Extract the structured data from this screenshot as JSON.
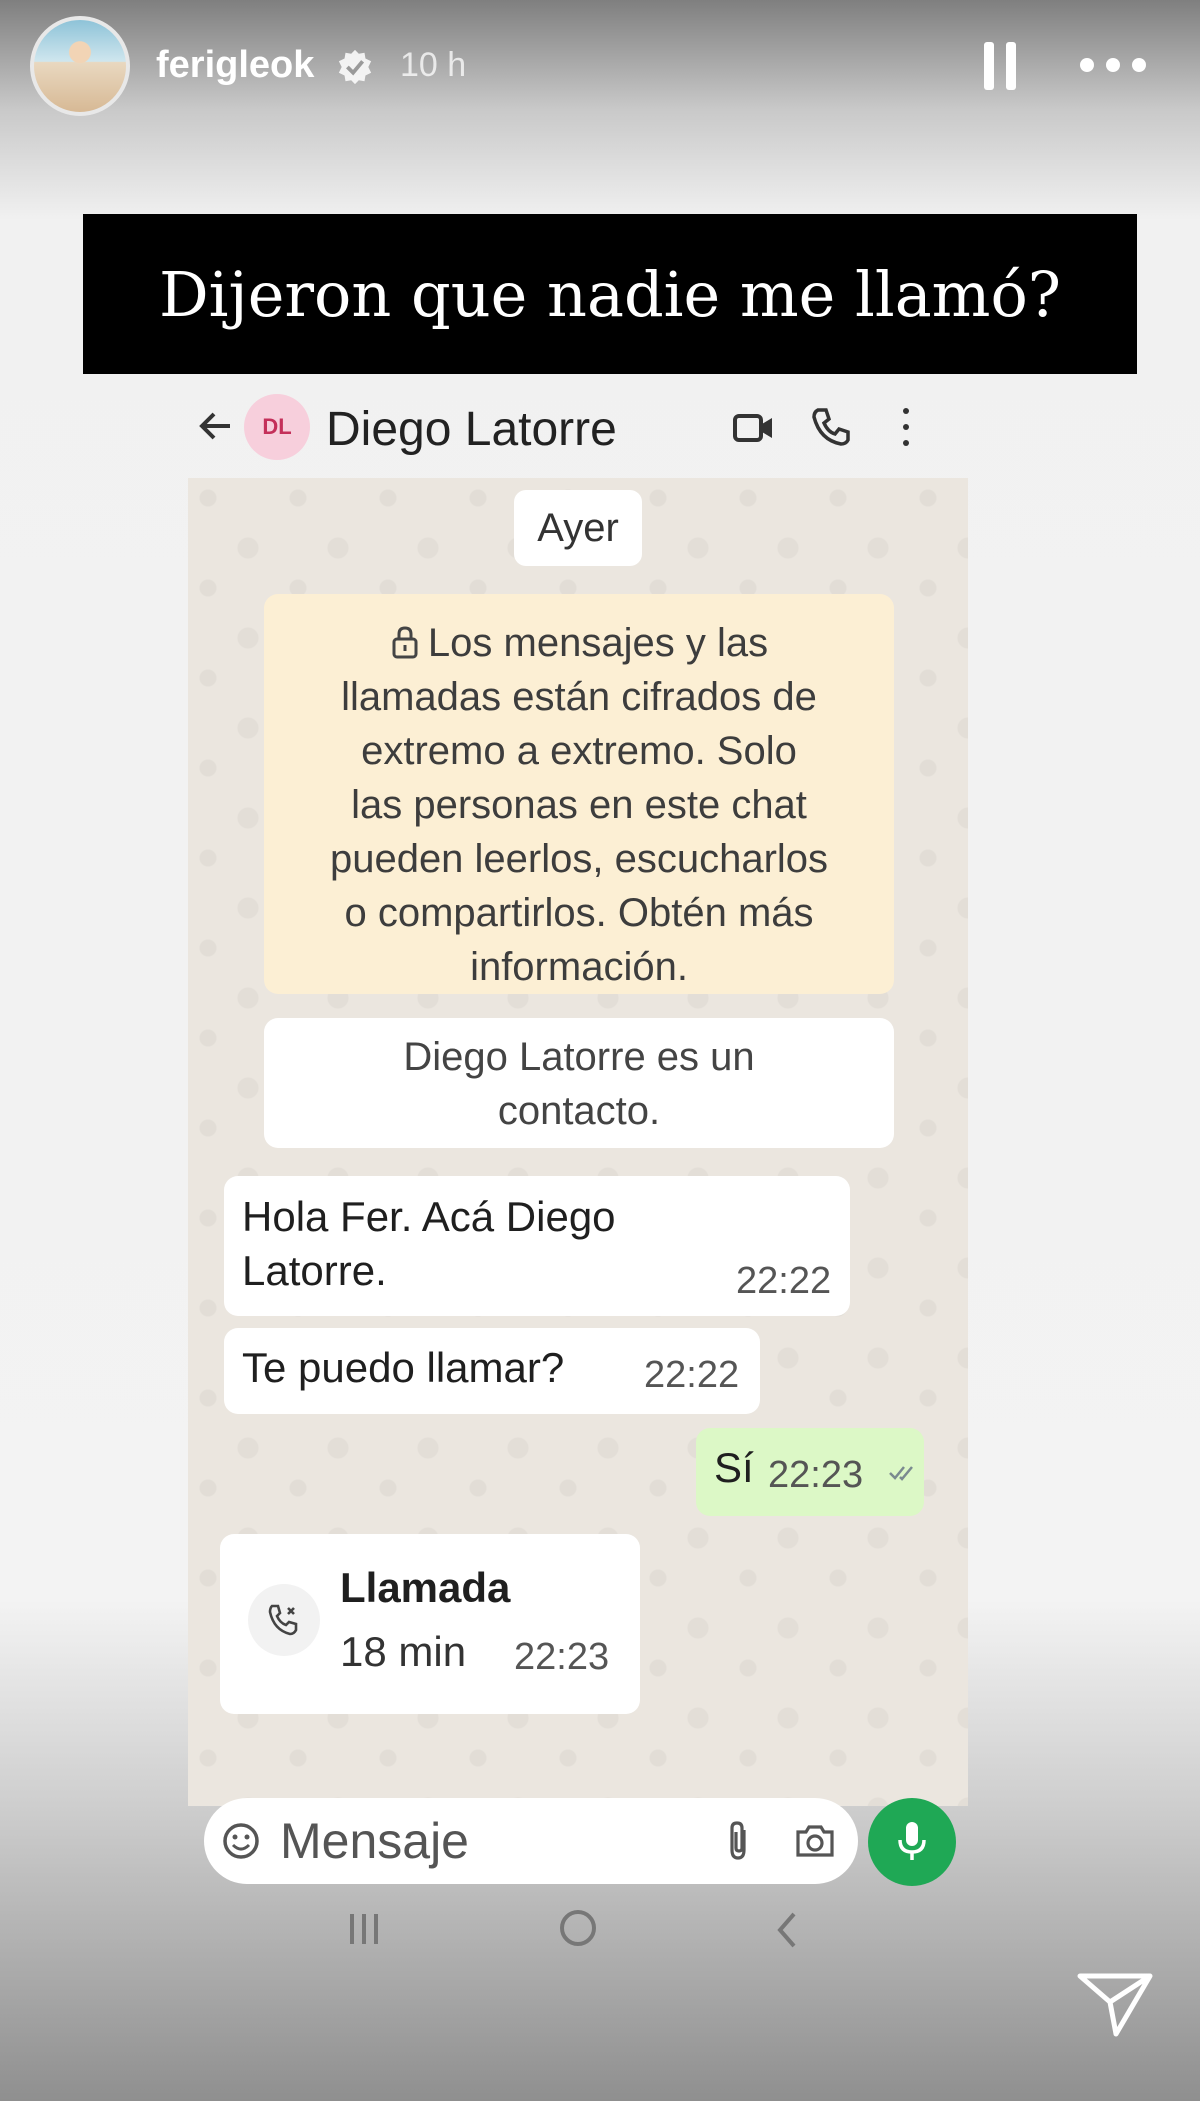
{
  "story": {
    "username": "ferigleok",
    "time_ago": "10 h",
    "caption": "Dijeron que nadie me llamó?"
  },
  "chat": {
    "contact_initials": "DL",
    "contact_name": "Diego Latorre",
    "date_divider": "Ayer",
    "encryption_notice": "Los mensajes y las llamadas están cifrados de extremo a extremo. Solo las personas en este chat pueden leerlos, escucharlos o compartirlos. Obtén más información.",
    "encryption_lines": [
      "Los mensajes y las",
      "llamadas están cifrados de",
      "extremo a extremo. Solo",
      "las personas en este chat",
      "pueden leerlos, escucharlos",
      "o compartirlos. Obtén más",
      "información."
    ],
    "contact_notice_lines": [
      "Diego Latorre es un",
      "contacto."
    ],
    "messages": [
      {
        "lines": [
          "Hola Fer. Acá Diego",
          "Latorre."
        ],
        "time": "22:22",
        "direction": "incoming"
      },
      {
        "text": "Te puedo llamar?",
        "time": "22:22",
        "direction": "incoming"
      },
      {
        "text": "Sí",
        "time": "22:23",
        "direction": "outgoing",
        "status": "read"
      }
    ],
    "call": {
      "title": "Llamada",
      "duration": "18 min",
      "time": "22:23"
    },
    "composer": {
      "placeholder": "Mensaje"
    }
  },
  "colors": {
    "caption_bg": "#000000",
    "encryption_bg": "#fcefd4",
    "outgoing_bubble": "#dcf8c6",
    "mic_button": "#1fa855",
    "avatar_badge": "#f7cfdc"
  },
  "icons": [
    "verified-icon",
    "pause-icon",
    "more-icon",
    "back-arrow-icon",
    "video-call-icon",
    "phone-icon",
    "menu-icon",
    "lock-icon",
    "read-check-icon",
    "incoming-call-icon",
    "emoji-icon",
    "attach-icon",
    "camera-icon",
    "mic-icon",
    "nav-recents-icon",
    "nav-home-icon",
    "nav-back-icon",
    "share-icon"
  ]
}
